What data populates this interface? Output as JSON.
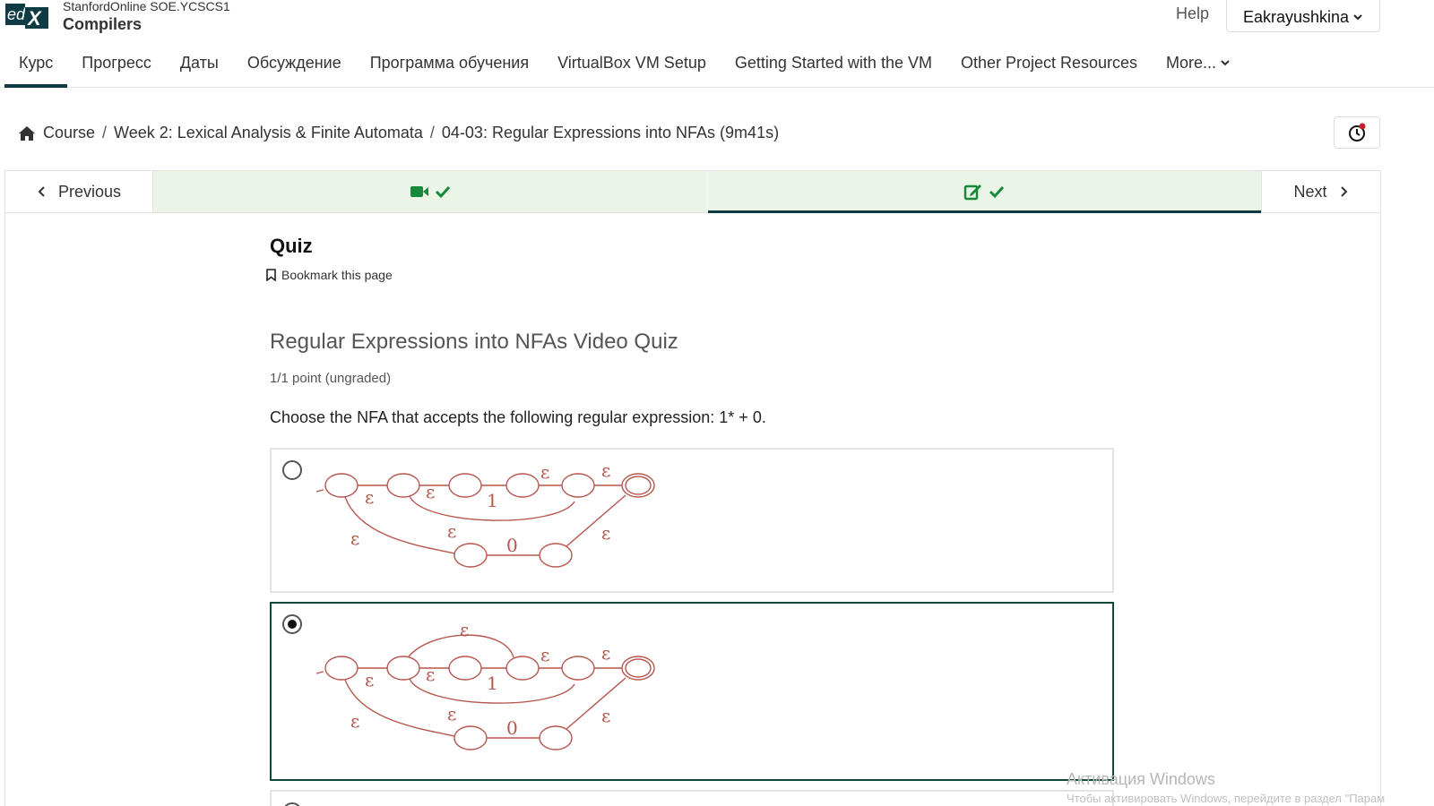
{
  "header": {
    "logo_text": "edX",
    "org": "StanfordOnline SOE.YCSCS1",
    "course_title": "Compilers",
    "help_label": "Help",
    "username": "Eakrayushkina"
  },
  "topnav": {
    "tabs": [
      {
        "label": "Курс",
        "active": true
      },
      {
        "label": "Прогресс"
      },
      {
        "label": "Даты"
      },
      {
        "label": "Обсуждение"
      },
      {
        "label": "Программа обучения"
      },
      {
        "label": "VirtualBox VM Setup"
      },
      {
        "label": "Getting Started with the VM"
      },
      {
        "label": "Other Project Resources"
      }
    ],
    "more_label": "More..."
  },
  "breadcrumb": {
    "home_label": "Course",
    "section": "Week 2: Lexical Analysis & Finite Automata",
    "unit": "04-03: Regular Expressions into NFAs (9m41s)",
    "separator": "/"
  },
  "sequence": {
    "previous_label": "Previous",
    "next_label": "Next",
    "units": [
      {
        "icon": "video-icon",
        "complete": true,
        "active": false
      },
      {
        "icon": "edit-icon",
        "complete": true,
        "active": true
      }
    ]
  },
  "content": {
    "unit_title": "Quiz",
    "bookmark_label": "Bookmark this page",
    "problem_title": "Regular Expressions into NFAs Video Quiz",
    "points": "1/1 point (ungraded)",
    "question": "Choose the NFA that accepts the following regular expression: 1* + 0.",
    "options": [
      {
        "selected": false,
        "labels": {
          "eps": "ε",
          "one": "1",
          "zero": "0"
        }
      },
      {
        "selected": true,
        "labels": {
          "eps": "ε",
          "one": "1",
          "zero": "0"
        }
      }
    ]
  },
  "colors": {
    "accent": "#0f3b44",
    "complete_bg": "#eaf5e7",
    "check_green": "#178a3a",
    "diagram": "#b5574d",
    "selected_border": "#0e4a3a"
  },
  "watermark": {
    "line1": "Активация Windows",
    "line2": "Чтобы активировать Windows, перейдите в раздел \"Парам"
  }
}
